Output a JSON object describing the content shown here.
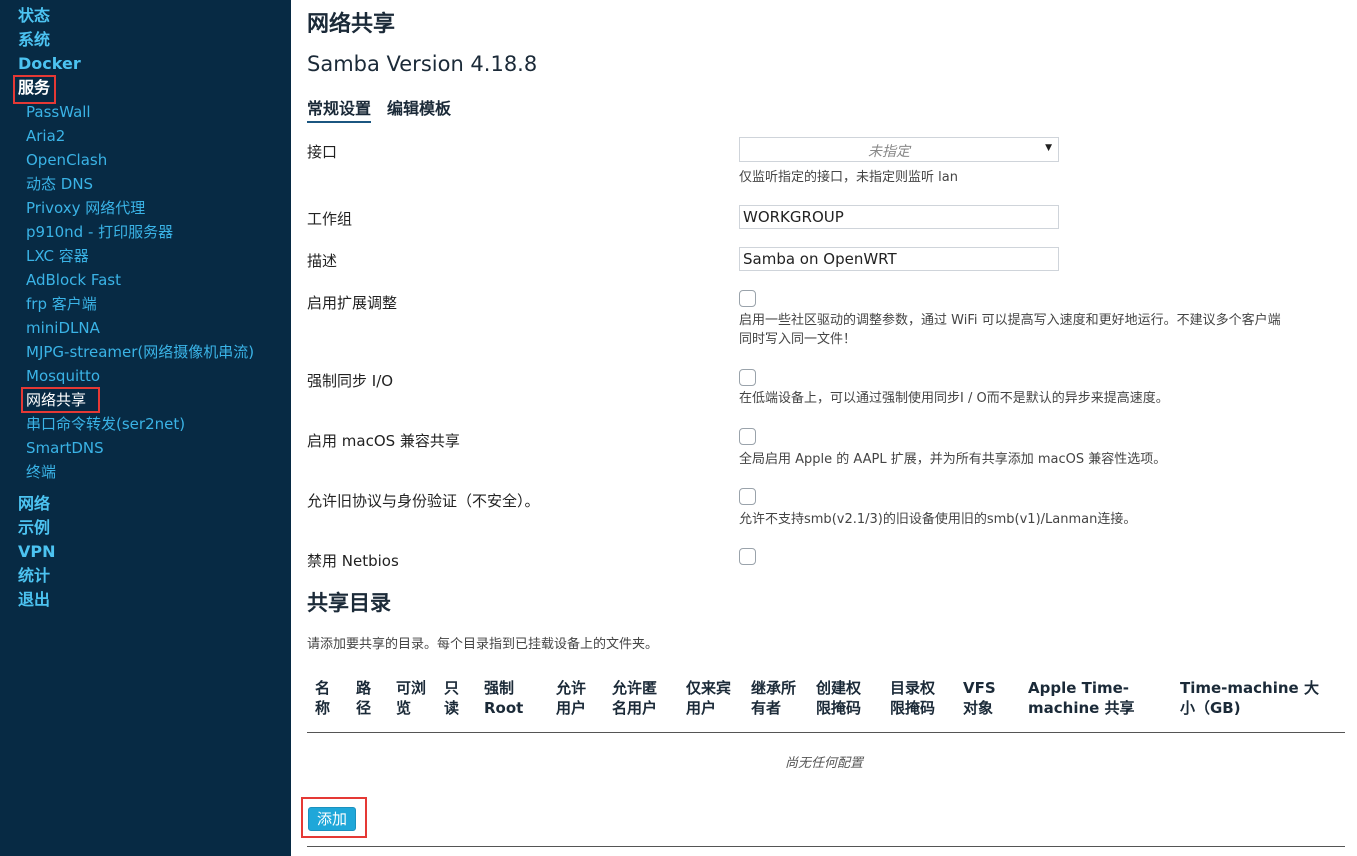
{
  "sidebar": {
    "top_items": [
      "状态",
      "系统",
      "Docker",
      "服务"
    ],
    "services": [
      "PassWall",
      "Aria2",
      "OpenClash",
      "动态 DNS",
      "Privoxy 网络代理",
      "p910nd - 打印服务器",
      "LXC 容器",
      "AdBlock Fast",
      "frp 客户端",
      "miniDLNA",
      "MJPG-streamer(网络摄像机串流)",
      "Mosquitto",
      "网络共享",
      "串口命令转发(ser2net)",
      "SmartDNS",
      "终端"
    ],
    "bottom_items": [
      "网络",
      "示例",
      "VPN",
      "统计",
      "退出"
    ],
    "active_top": "服务",
    "active_service": "网络共享"
  },
  "page": {
    "title": "网络共享",
    "subtitle": "Samba Version 4.18.8",
    "tabs": [
      "常规设置",
      "编辑模板"
    ],
    "active_tab": "常规设置"
  },
  "form": {
    "interface": {
      "label": "接口",
      "placeholder": "未指定",
      "desc": "仅监听指定的接口，未指定则监听 lan"
    },
    "workgroup": {
      "label": "工作组",
      "value": "WORKGROUP"
    },
    "description": {
      "label": "描述",
      "value": "Samba on OpenWRT"
    },
    "extended_tuning": {
      "label": "启用扩展调整",
      "checked": false,
      "desc_line1": "启用一些社区驱动的调整参数，通过 WiFi 可以提高写入速度和更好地运行。不建议多个客户端",
      "desc_line2": "同时写入同一文件！"
    },
    "force_sync_io": {
      "label": "强制同步 I/O",
      "checked": false,
      "desc": "在低端设备上，可以通过强制使用同步I / O而不是默认的异步来提高速度。"
    },
    "macos_compat": {
      "label": "启用 macOS 兼容共享",
      "checked": false,
      "desc": "全局启用 Apple 的 AAPL 扩展，并为所有共享添加 macOS 兼容性选项。"
    },
    "legacy_protocol": {
      "label": "允许旧协议与身份验证（不安全）。",
      "checked": false,
      "desc": "允许不支持smb(v2.1/3)的旧设备使用旧的smb(v1)/Lanman连接。"
    },
    "disable_netbios": {
      "label": "禁用 Netbios",
      "checked": false
    }
  },
  "shares": {
    "title": "共享目录",
    "desc": "请添加要共享的目录。每个目录指到已挂载设备上的文件夹。",
    "headers": [
      [
        "名",
        "称"
      ],
      [
        "路",
        "径"
      ],
      [
        "可浏",
        "览"
      ],
      [
        "只",
        "读"
      ],
      [
        "强制",
        "Root"
      ],
      [
        "允许",
        "用户"
      ],
      [
        "允许匿",
        "名用户"
      ],
      [
        "仅来宾",
        "用户"
      ],
      [
        "继承所",
        "有者"
      ],
      [
        "创建权",
        "限掩码"
      ],
      [
        "目录权",
        "限掩码"
      ],
      [
        "VFS",
        "对象"
      ],
      [
        "Apple Time-",
        "machine 共享"
      ],
      [
        "Time-machine 大",
        "小（GB)"
      ]
    ],
    "empty_text": "尚无任何配置",
    "add_label": "添加"
  }
}
